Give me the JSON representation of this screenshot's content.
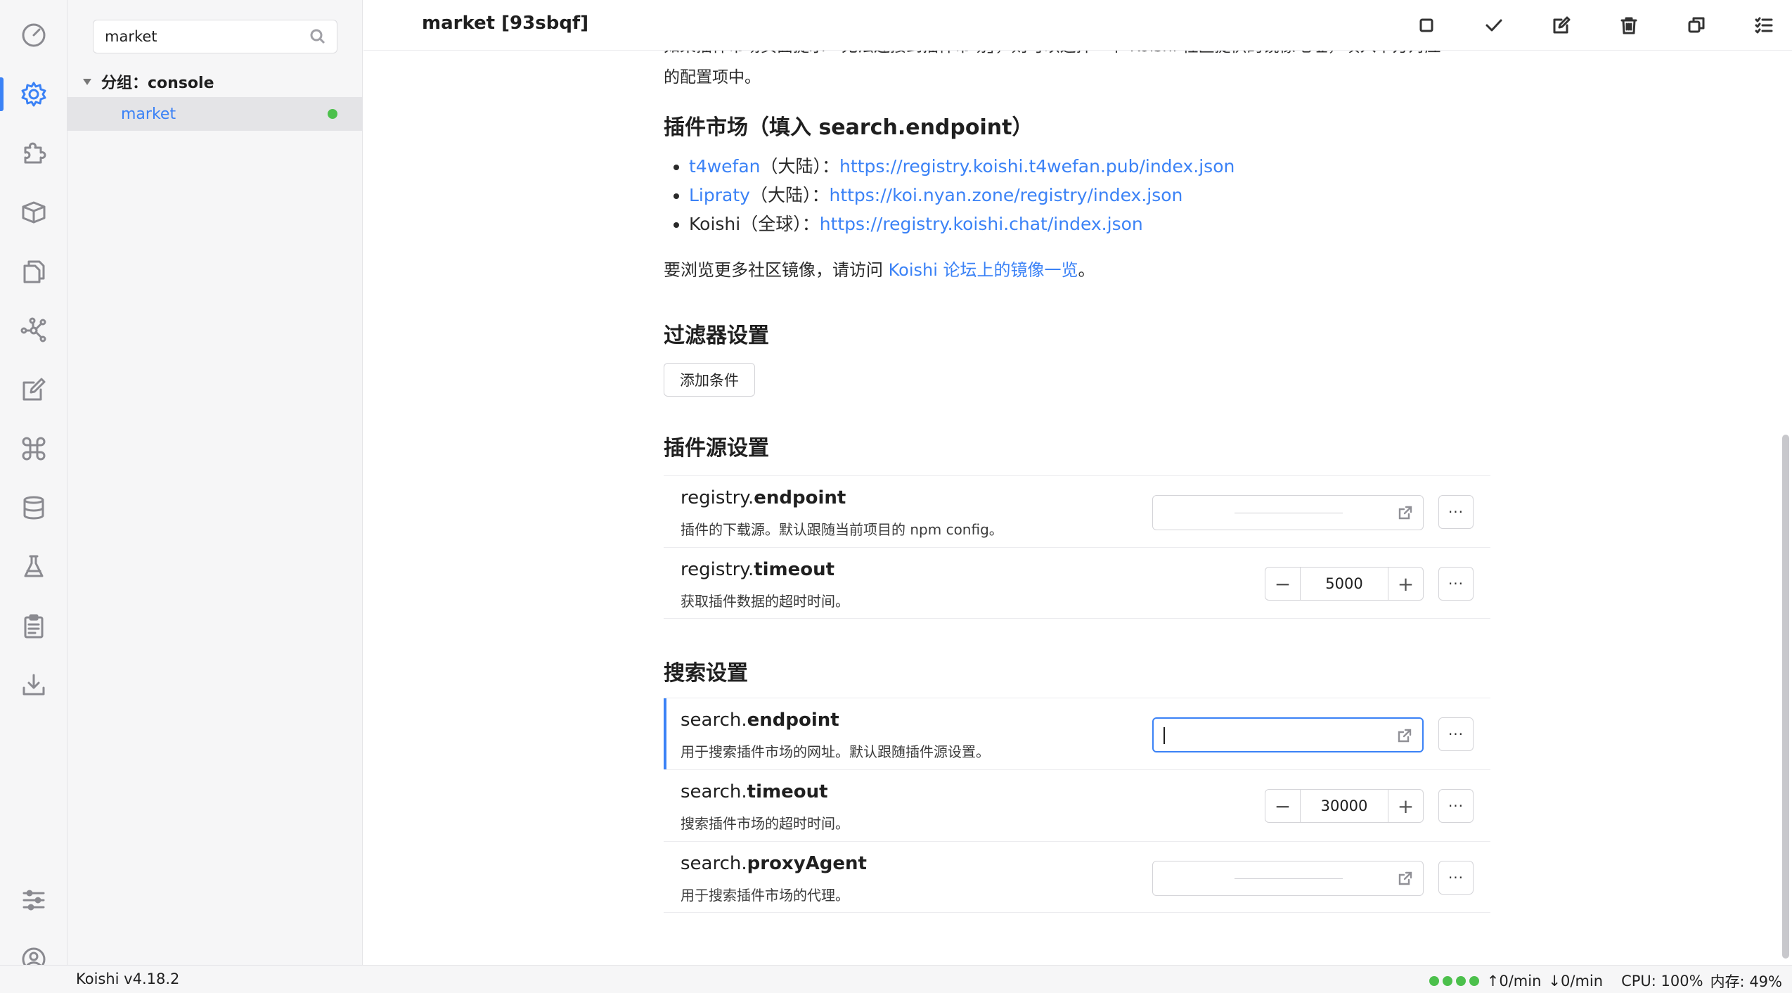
{
  "window": {
    "title": "market [93sbqf]"
  },
  "activity_bar": {
    "items": [
      {
        "icon": "dashboard-icon"
      },
      {
        "icon": "gear-icon",
        "active": true
      },
      {
        "icon": "puzzle-icon"
      },
      {
        "icon": "package-icon"
      },
      {
        "icon": "files-icon"
      },
      {
        "icon": "network-icon"
      },
      {
        "icon": "edit-icon"
      },
      {
        "icon": "command-icon"
      },
      {
        "icon": "database-icon"
      },
      {
        "icon": "flask-icon"
      },
      {
        "icon": "clipboard-icon"
      },
      {
        "icon": "download-icon"
      },
      {
        "icon": "sliders-icon"
      },
      {
        "icon": "user-icon"
      }
    ]
  },
  "sidebar": {
    "search_value": "market",
    "group_label": "分组：console",
    "plugin_label": "market",
    "plugin_status_color": "#4cc04c"
  },
  "header": {
    "actions": [
      "stop-icon",
      "check-icon",
      "edit-icon",
      "trash-icon",
      "copy-icon",
      "list-check-icon"
    ]
  },
  "content": {
    "cut_text": "如果插件市场页面提示「无法连接到插件市场」，则可以选择一个 Koishi 社区提供的镜像地址，填入下方对应",
    "cut_text_tail": "的配置项中。",
    "market_heading": "插件市场（填入 search.endpoint）",
    "mirrors": [
      {
        "name": "t4wefan",
        "name_is_link": true,
        "region": "（大陆）：",
        "url": "https://registry.koishi.t4wefan.pub/index.json"
      },
      {
        "name": "Lipraty",
        "name_is_link": true,
        "region": "（大陆）：",
        "url": "https://koi.nyan.zone/registry/index.json"
      },
      {
        "name": "Koishi",
        "name_is_link": false,
        "region": "（全球）：",
        "url": "https://registry.koishi.chat/index.json"
      }
    ],
    "more_prefix": "要浏览更多社区镜像，请访问 ",
    "more_link": "Koishi 论坛上的镜像一览",
    "more_suffix": "。",
    "filter_heading": "过滤器设置",
    "add_condition_label": "添加条件",
    "registry_heading": "插件源设置",
    "search_heading": "搜索设置",
    "registry_settings": [
      {
        "prefix": "registry.",
        "key": "endpoint",
        "desc": "插件的下载源。默认跟随当前项目的 npm config。",
        "type": "text",
        "value": ""
      },
      {
        "prefix": "registry.",
        "key": "timeout",
        "desc": "获取插件数据的超时时间。",
        "type": "number",
        "value": "5000"
      }
    ],
    "search_settings": [
      {
        "prefix": "search.",
        "key": "endpoint",
        "desc": "用于搜索插件市场的网址。默认跟随插件源设置。",
        "type": "text",
        "value": "",
        "focused": true
      },
      {
        "prefix": "search.",
        "key": "timeout",
        "desc": "搜索插件市场的超时时间。",
        "type": "number",
        "value": "30000"
      },
      {
        "prefix": "search.",
        "key": "proxyAgent",
        "desc": "用于搜索插件市场的代理。",
        "type": "text",
        "value": ""
      }
    ],
    "more_label": "···",
    "minus_label": "−",
    "plus_label": "+"
  },
  "statusbar": {
    "version": "Koishi v4.18.2",
    "upload_rate": "0/min",
    "download_rate": "0/min",
    "cpu": "CPU: 100%",
    "memory": "内存: 49%"
  }
}
